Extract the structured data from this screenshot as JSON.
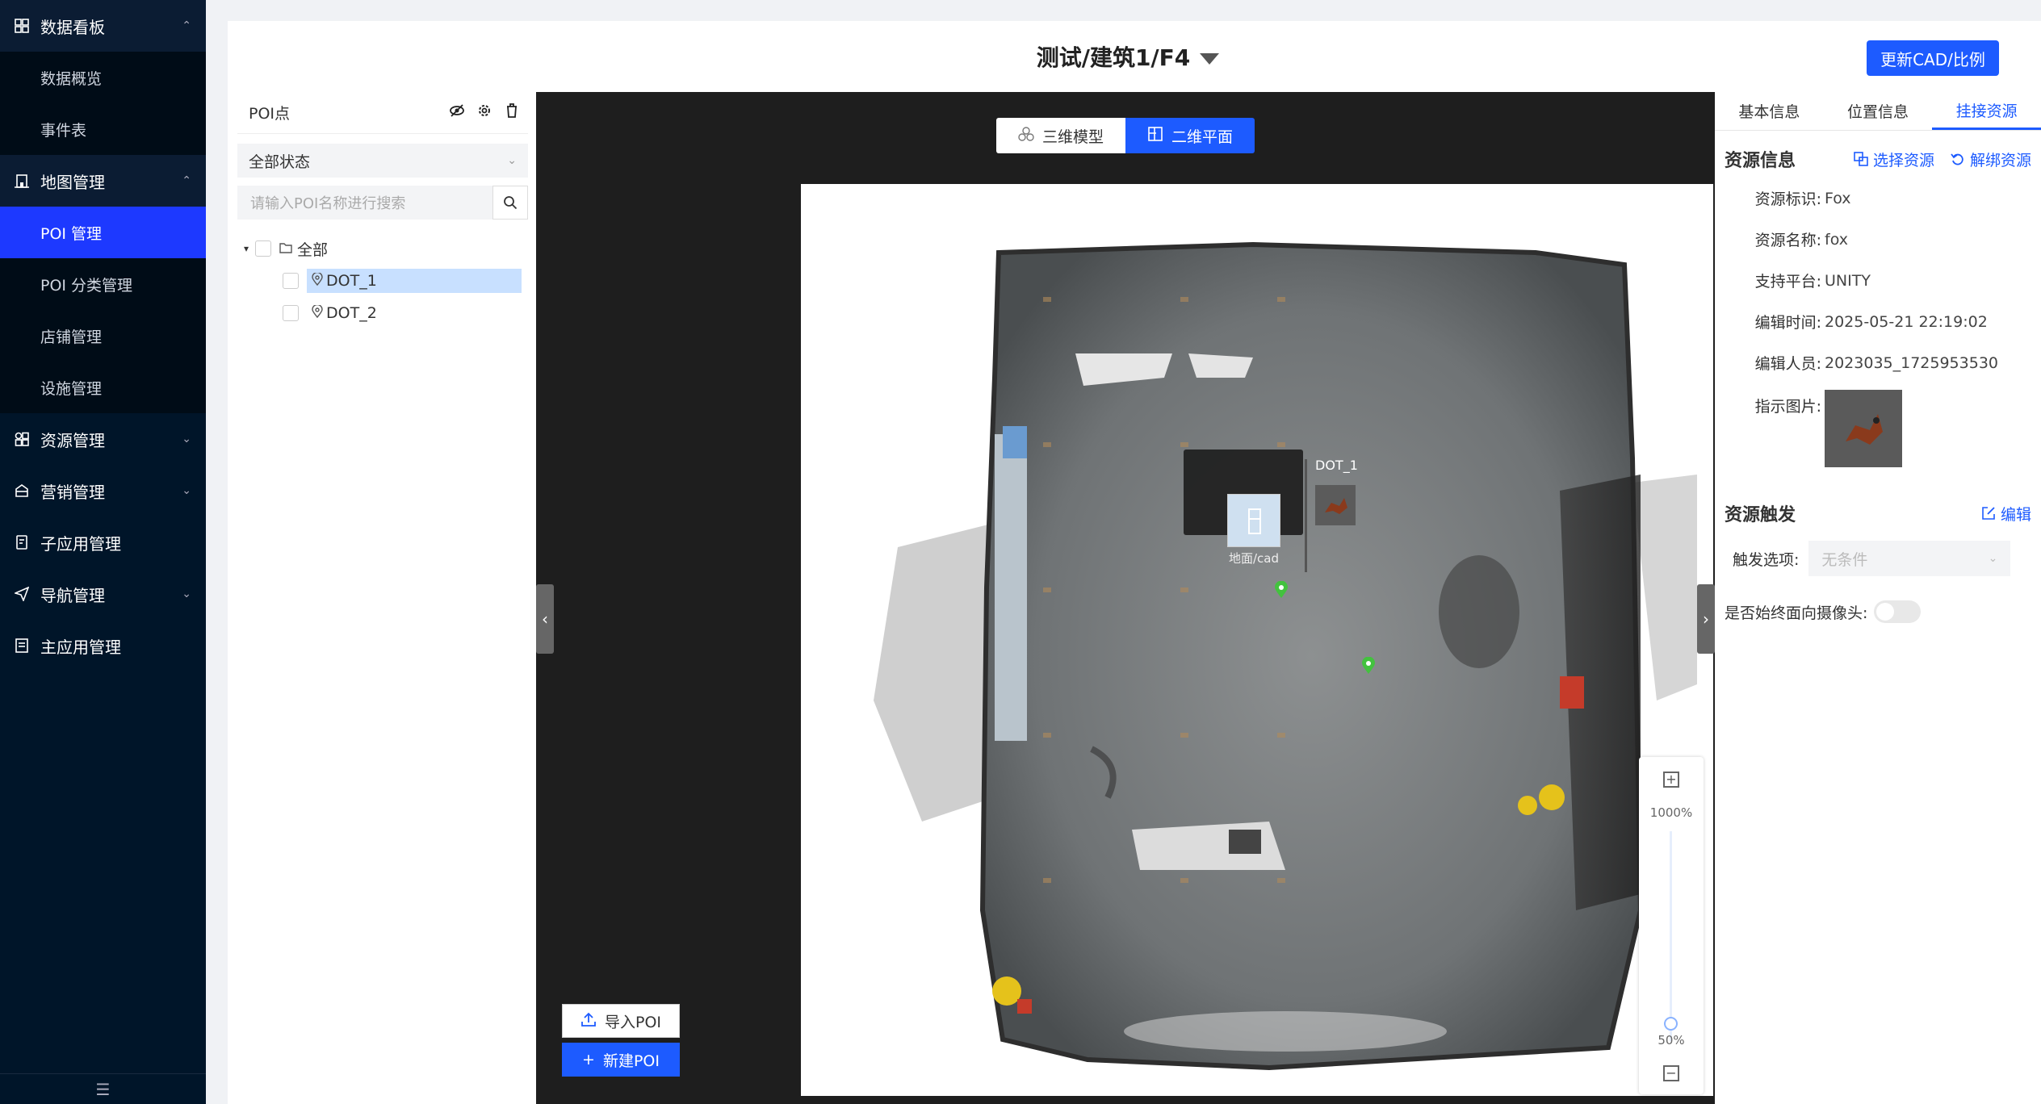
{
  "sidebar": {
    "groups": [
      {
        "label": "数据看板",
        "icon": "dashboard-icon",
        "open": true,
        "items": [
          "数据概览",
          "事件表"
        ]
      },
      {
        "label": "地图管理",
        "icon": "building-icon",
        "open": true,
        "items": [
          "POI 管理",
          "POI 分类管理",
          "店铺管理",
          "设施管理"
        ]
      },
      {
        "label": "资源管理",
        "icon": "grid-icon"
      },
      {
        "label": "营销管理",
        "icon": "shop-icon"
      },
      {
        "label": "子应用管理",
        "icon": "app-icon"
      },
      {
        "label": "导航管理",
        "icon": "send-icon"
      },
      {
        "label": "主应用管理",
        "icon": "doc-icon"
      }
    ],
    "active_item": "POI 管理"
  },
  "header": {
    "title": "测试/建筑1/F4",
    "update_button": "更新CAD/比例"
  },
  "left_panel": {
    "title": "POI点",
    "status_select": "全部状态",
    "search_placeholder": "请输入POI名称进行搜索",
    "tree_root": "全部",
    "tree_items": [
      "DOT_1",
      "DOT_2"
    ],
    "selected": "DOT_1"
  },
  "canvas": {
    "view_3d": "三维模型",
    "view_2d": "二维平面",
    "active_view": "二维平面",
    "popup_name": "DOT_1",
    "popup_caption": "地面/cad",
    "zoom_max": "1000%",
    "zoom_current": "50%",
    "import_button": "导入POI",
    "new_button": "新建POI"
  },
  "right_panel": {
    "tabs": [
      "基本信息",
      "位置信息",
      "挂接资源"
    ],
    "active_tab": "挂接资源",
    "resource_title": "资源信息",
    "select_resource": "选择资源",
    "unbind_resource": "解绑资源",
    "fields": [
      {
        "k": "资源标识:",
        "v": "Fox"
      },
      {
        "k": "资源名称:",
        "v": "fox"
      },
      {
        "k": "支持平台:",
        "v": "UNITY"
      },
      {
        "k": "编辑时间:",
        "v": "2025-05-21 22:19:02"
      },
      {
        "k": "编辑人员:",
        "v": "2023035_1725953530"
      },
      {
        "k": "指示图片:",
        "v": ""
      }
    ],
    "trigger_title": "资源触发",
    "edit_label": "编辑",
    "trigger_label": "触发选项:",
    "trigger_value": "无条件",
    "camera_label": "是否始终面向摄像头:"
  }
}
